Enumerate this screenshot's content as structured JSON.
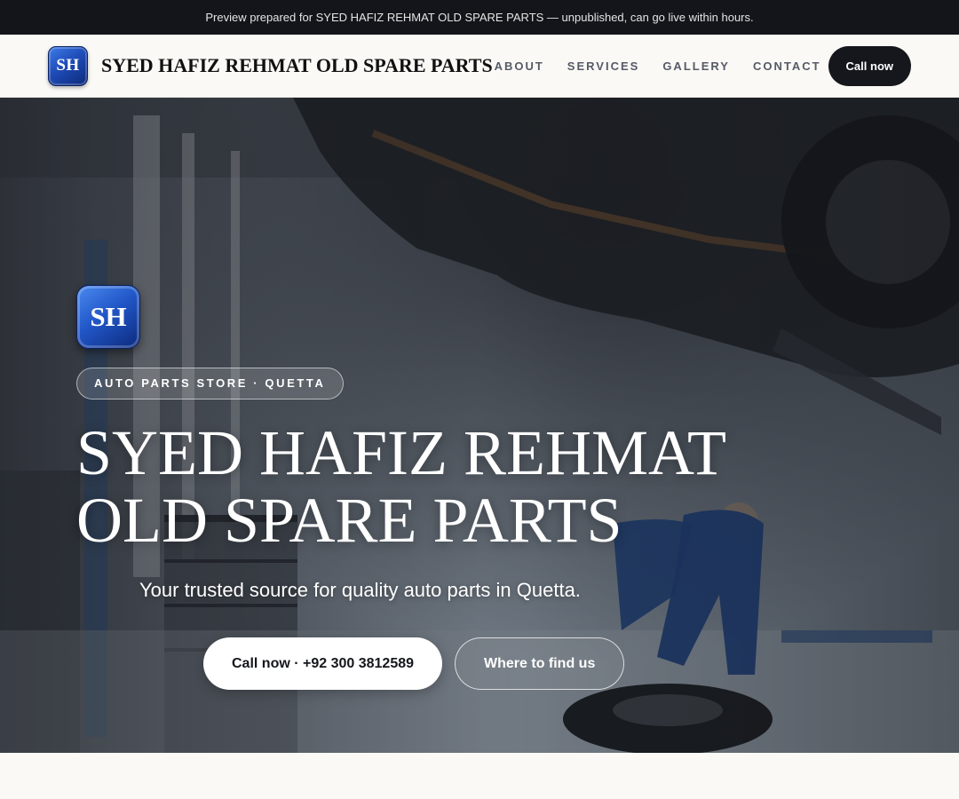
{
  "preview_banner": {
    "text": "Preview prepared for SYED HAFIZ REHMAT OLD SPARE PARTS — unpublished, can go live within hours."
  },
  "header": {
    "logo_initials": "SH",
    "brand_name": "SYED HAFIZ REHMAT OLD SPARE PARTS",
    "nav": [
      {
        "label": "ABOUT"
      },
      {
        "label": "SERVICES"
      },
      {
        "label": "GALLERY"
      },
      {
        "label": "CONTACT"
      }
    ],
    "cta_label": "Call now"
  },
  "hero": {
    "logo_initials": "SH",
    "tag": "AUTO PARTS STORE · QUETTA",
    "title_line1": "SYED HAFIZ REHMAT",
    "title_line2": "OLD SPARE PARTS",
    "subtitle": "Your trusted source for quality auto parts in Quetta.",
    "primary_button": "Call now · +92 300 3812589",
    "secondary_button": "Where to find us"
  },
  "colors": {
    "dark": "#15171c",
    "logo_blue": "#1f4cb8",
    "page_bg": "#faf9f6",
    "mechanic_blue": "#1d3f7a"
  }
}
